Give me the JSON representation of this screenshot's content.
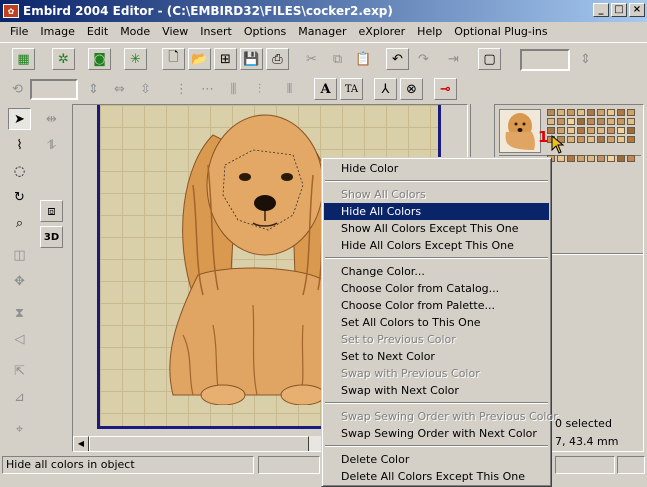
{
  "window": {
    "title": "Embird 2004 Editor - (C:\\EMBIRD32\\FILES\\cocker2.exp)",
    "controls": [
      "_",
      "□",
      "×"
    ]
  },
  "menu": [
    "File",
    "Image",
    "Edit",
    "Mode",
    "View",
    "Insert",
    "Options",
    "Manager",
    "eXplorer",
    "Help",
    "Optional Plug-ins"
  ],
  "toolbar2": {
    "text_icon_a": "A",
    "text_icon_b": "TA",
    "key_icon": "⊸"
  },
  "left_tools": {
    "label_3d": "3D"
  },
  "context_menu": {
    "items": [
      {
        "label": "Hide Color",
        "state": "normal"
      },
      {
        "sep": true
      },
      {
        "label": "Show All Colors",
        "state": "disabled"
      },
      {
        "label": "Hide All Colors",
        "state": "selected"
      },
      {
        "label": "Show All Colors Except This One",
        "state": "normal"
      },
      {
        "label": "Hide All Colors Except This One",
        "state": "normal"
      },
      {
        "sep": true
      },
      {
        "label": "Change Color...",
        "state": "normal"
      },
      {
        "label": "Choose Color from Catalog...",
        "state": "normal"
      },
      {
        "label": "Choose Color from Palette...",
        "state": "normal"
      },
      {
        "label": "Set All Colors to This One",
        "state": "normal"
      },
      {
        "label": "Set to Previous Color",
        "state": "disabled"
      },
      {
        "label": "Set to Next Color",
        "state": "normal"
      },
      {
        "label": "Swap with Previous Color",
        "state": "disabled"
      },
      {
        "label": "Swap with Next Color",
        "state": "normal"
      },
      {
        "sep": true
      },
      {
        "label": "Swap Sewing Order with Previous Color",
        "state": "disabled"
      },
      {
        "label": "Swap Sewing Order with Next Color",
        "state": "normal"
      },
      {
        "sep": true
      },
      {
        "label": "Delete Color",
        "state": "normal"
      },
      {
        "label": "Delete All Colors Except This One",
        "state": "normal"
      }
    ]
  },
  "annotations": {
    "one": "1",
    "two": "2"
  },
  "right_panel": {
    "selected_text": "0 selected",
    "size_text": "7, 43.4 mm"
  },
  "statusbar": {
    "message": "Hide all colors in object"
  },
  "colors": {
    "selection": "#0a246a",
    "hoop_border": "#1a1a80",
    "hoop_fill": "#d9cfa9",
    "dog_main": "#d9994f",
    "dog_dark": "#8a5424",
    "annotation_red": "#e00000"
  },
  "swatch_colors": [
    "#b48a5a",
    "#d8b27a",
    "#c8965c",
    "#e0c08a",
    "#a8784a",
    "#cda070",
    "#e8c890",
    "#b07840",
    "#d0a468",
    "#dcb888",
    "#c49060",
    "#f0d4a0",
    "#9c6c3c",
    "#c08858"
  ]
}
